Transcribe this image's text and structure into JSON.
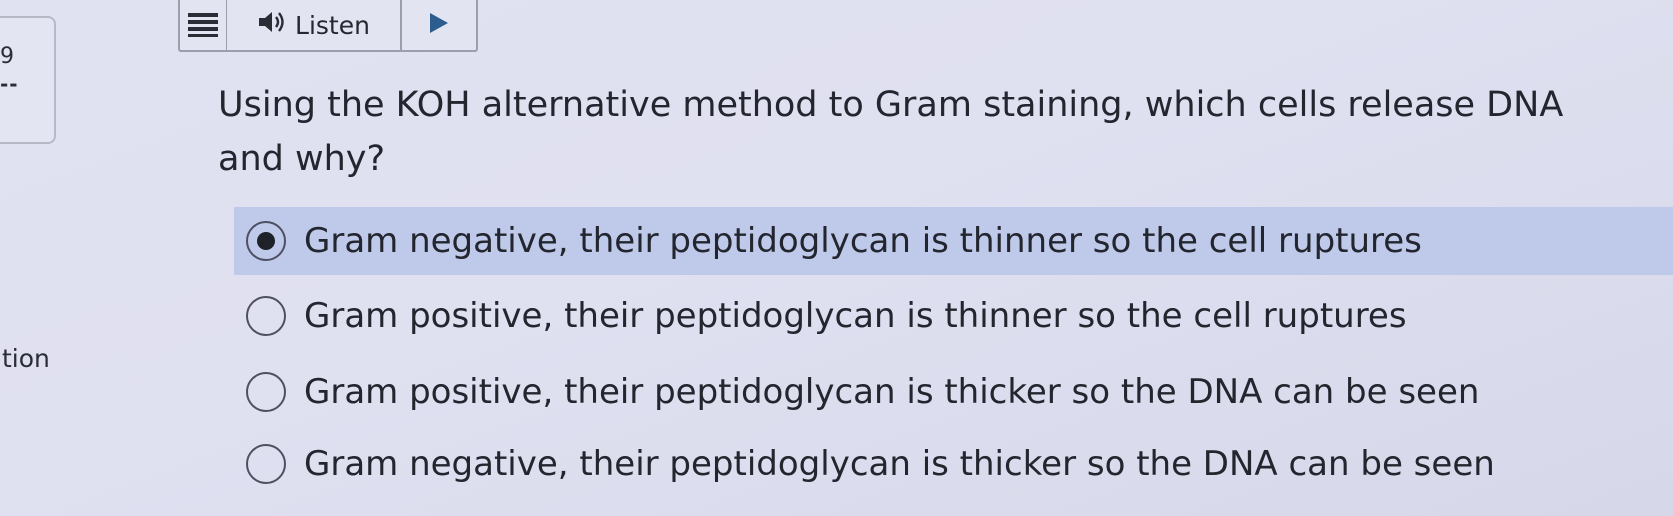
{
  "sidebar": {
    "question_number": "9",
    "question_status": "--",
    "partial_label": "tion"
  },
  "toolbar": {
    "menu_icon": "hamburger-menu-icon",
    "speaker_icon": "speaker-icon",
    "listen_label": "Listen",
    "play_icon": "play-icon"
  },
  "question": {
    "text": "Using the KOH alternative method to Gram staining, which cells release DNA and why?"
  },
  "options": [
    {
      "label": "Gram negative, their peptidoglycan is thinner so the cell ruptures",
      "selected": true
    },
    {
      "label": "Gram positive, their peptidoglycan is thinner so the cell ruptures",
      "selected": false
    },
    {
      "label": "Gram positive, their peptidoglycan is thicker so the DNA can be seen",
      "selected": false
    },
    {
      "label": "Gram negative, their peptidoglycan is thicker so the DNA can be seen",
      "selected": false
    }
  ],
  "colors": {
    "selected_highlight": "#bfcaeb",
    "background": "#dfe0f0",
    "play_accent": "#2c5d8f"
  }
}
